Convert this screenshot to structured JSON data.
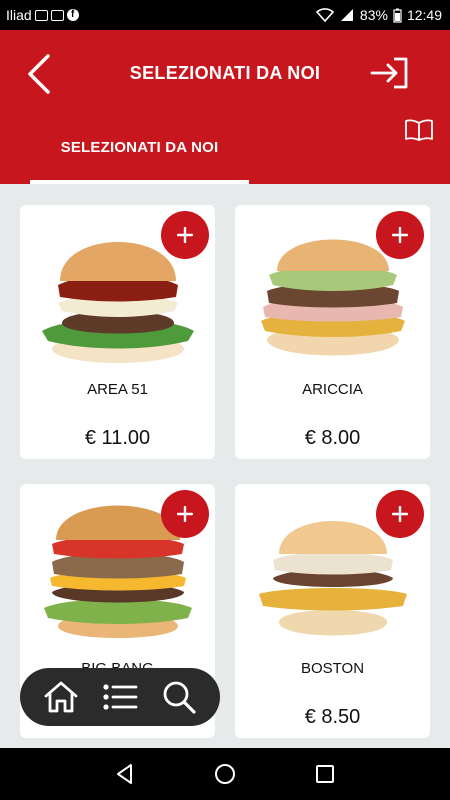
{
  "status_bar": {
    "carrier": "Iliad",
    "battery": "83%",
    "time": "12:49"
  },
  "header": {
    "title": "SELEZIONATI DA NOI",
    "tab_label": "SELEZIONATI DA NOI"
  },
  "colors": {
    "primary": "#c8161e",
    "background": "#e6eaea",
    "nav_dark": "#2b2b2b"
  },
  "products": [
    {
      "name": "AREA 51",
      "price": "€ 11.00"
    },
    {
      "name": "ARICCIA",
      "price": "€ 8.00"
    },
    {
      "name": "BIG BANG",
      "price": ""
    },
    {
      "name": "BOSTON",
      "price": "€ 8.50"
    }
  ],
  "icons": {
    "back": "back-arrow-icon",
    "login": "login-icon",
    "book": "book-icon",
    "add": "plus-icon",
    "home": "home-icon",
    "list": "list-icon",
    "search": "search-icon"
  }
}
